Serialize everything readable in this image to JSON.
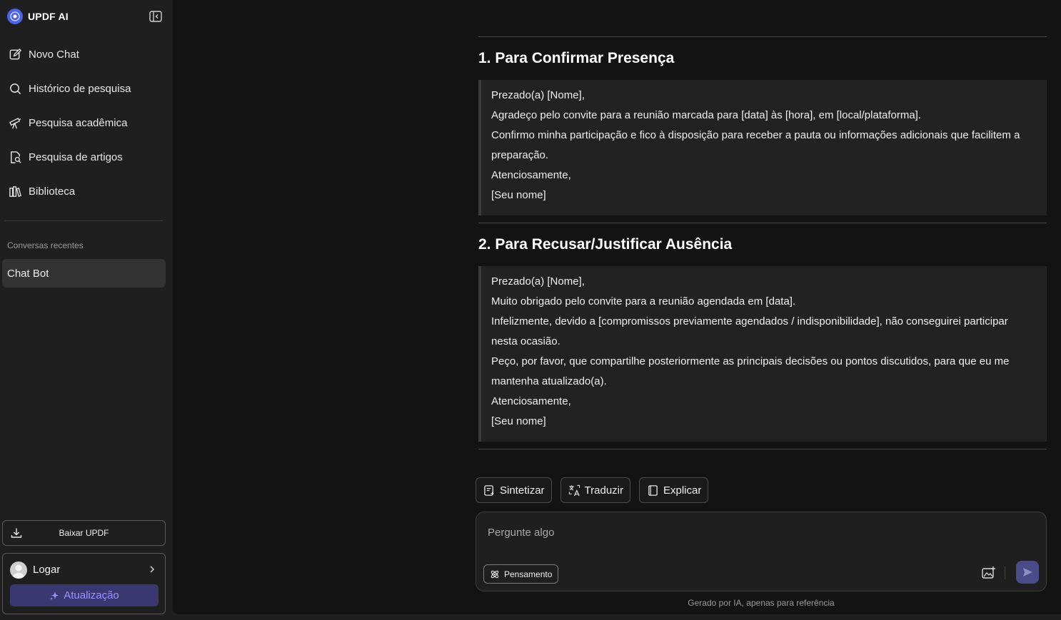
{
  "brand": {
    "name": "UPDF AI",
    "accent": "#4b63e6"
  },
  "sidebar": {
    "items": [
      {
        "label": "Novo Chat",
        "icon": "edit-icon"
      },
      {
        "label": "Histórico de pesquisa",
        "icon": "search-icon"
      },
      {
        "label": "Pesquisa acadêmica",
        "icon": "telescope-icon"
      },
      {
        "label": "Pesquisa de artigos",
        "icon": "document-search-icon"
      },
      {
        "label": "Biblioteca",
        "icon": "library-icon"
      }
    ],
    "recent_title": "Conversas recentes",
    "recent": [
      {
        "label": "Chat Bot"
      }
    ],
    "download_label": "Baixar UPDF",
    "login_label": "Logar",
    "upgrade_label": "Atualização"
  },
  "content": {
    "sections": [
      {
        "title": "1. Para Confirmar Presença",
        "lines": [
          "Prezado(a) [Nome],",
          "Agradeço pelo convite para a reunião marcada para [data] às [hora], em [local/plataforma].",
          "Confirmo minha participação e fico à disposição para receber a pauta ou informações adicionais que facilitem a",
          "preparação.",
          "Atenciosamente,",
          "[Seu nome]"
        ]
      },
      {
        "title": "2. Para Recusar/Justificar Ausência",
        "lines": [
          "Prezado(a) [Nome],",
          "Muito obrigado pelo convite para a reunião agendada em [data].",
          "Infelizmente, devido a [compromissos previamente agendados / indisponibilidade], não conseguirei participar",
          "nesta ocasião.",
          "Peço, por favor, que compartilhe posteriormente as principais decisões ou pontos discutidos, para que eu me",
          "mantenha atualizado(a).",
          "Atenciosamente,",
          "[Seu nome]"
        ]
      }
    ]
  },
  "actions": {
    "summarize": "Sintetizar",
    "translate": "Traduzir",
    "explain": "Explicar"
  },
  "input": {
    "placeholder": "Pergunte algo",
    "thinking_label": "Pensamento"
  },
  "disclaimer": "Gerado por IA, apenas para referência"
}
